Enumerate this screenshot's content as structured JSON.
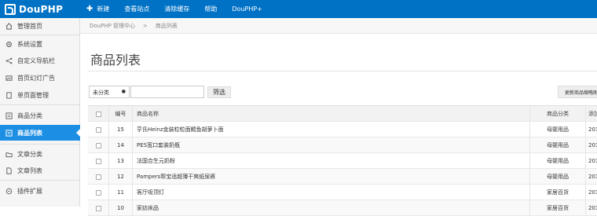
{
  "app": {
    "logo_text": "DouPHP"
  },
  "topnav": {
    "new_label": "新建",
    "items": [
      "查看站点",
      "清除缓存",
      "帮助",
      "DouPHP+"
    ]
  },
  "sidebar": {
    "items": [
      {
        "label": "管理首页",
        "icon": "home-icon"
      },
      {
        "label": "系统设置",
        "icon": "gear-icon"
      },
      {
        "label": "自定义导航栏",
        "icon": "share-icon"
      },
      {
        "label": "首页幻灯广告",
        "icon": "image-icon"
      },
      {
        "label": "单页面管理",
        "icon": "page-icon"
      },
      {
        "label": "商品分类",
        "icon": "category-icon"
      },
      {
        "label": "商品列表",
        "icon": "list-icon",
        "active": true
      },
      {
        "label": "文章分类",
        "icon": "folder-icon"
      },
      {
        "label": "文章列表",
        "icon": "document-icon"
      },
      {
        "label": "插件扩展",
        "icon": "plugin-icon"
      }
    ]
  },
  "breadcrumb": {
    "root": "DouPHP 管理中心",
    "separator": ">",
    "current": "商品列表"
  },
  "page": {
    "title": "商品列表"
  },
  "filter": {
    "category_value": "未分类",
    "search_value": "",
    "filter_button": "筛选",
    "update_button": "更新商品缩略图"
  },
  "table": {
    "headers": {
      "id": "编号",
      "name": "商品名称",
      "category": "商品分类",
      "date": "添加"
    },
    "rows": [
      {
        "id": "15",
        "name": "亨氏Heinz金装粒粒面鳕鱼胡萝卜面",
        "category": "母婴用品",
        "date": "2013"
      },
      {
        "id": "14",
        "name": "PES宽口套装奶瓶",
        "category": "母婴用品",
        "date": "2013"
      },
      {
        "id": "13",
        "name": "法国合生元奶粉",
        "category": "母婴用品",
        "date": "2013"
      },
      {
        "id": "12",
        "name": "Pampers帮宝适超薄干爽纸尿裤",
        "category": "母婴用品",
        "date": "2013"
      },
      {
        "id": "11",
        "name": "客厅吸顶灯",
        "category": "家居百货",
        "date": "2013"
      },
      {
        "id": "10",
        "name": "家纺床品",
        "category": "家居百货",
        "date": "2013"
      }
    ]
  },
  "colors": {
    "topbar": "#0072c6",
    "sidebar_active": "#1c8ee3"
  }
}
